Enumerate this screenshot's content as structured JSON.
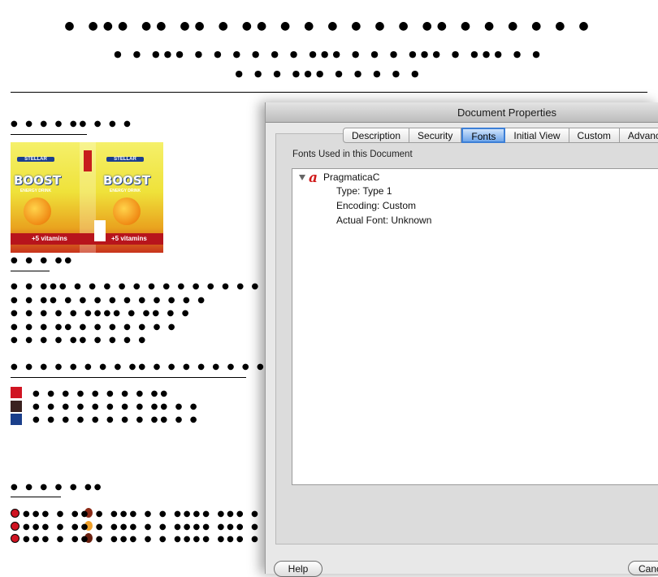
{
  "dialog": {
    "title": "Document Properties",
    "tabs": [
      "Description",
      "Security",
      "Fonts",
      "Initial View",
      "Custom",
      "Advance"
    ],
    "active_tab": "Fonts",
    "fonts_label": "Fonts Used in this Document",
    "font": {
      "name": "PragmaticaC",
      "type": "Type: Type 1",
      "encoding": "Encoding: Custom",
      "actual_font": "Actual Font: Unknown"
    },
    "help_label": "Help",
    "cancel_label": "Canc"
  },
  "artwork": {
    "brand": "STELLAR",
    "product": "BOOST",
    "subtitle": "ENERGY DRINK",
    "band_text": "+5 vitamins"
  },
  "colors": {
    "swatch_red": "#d01422",
    "swatch_brown": "#3a2220",
    "swatch_blue": "#1b3f8b"
  }
}
